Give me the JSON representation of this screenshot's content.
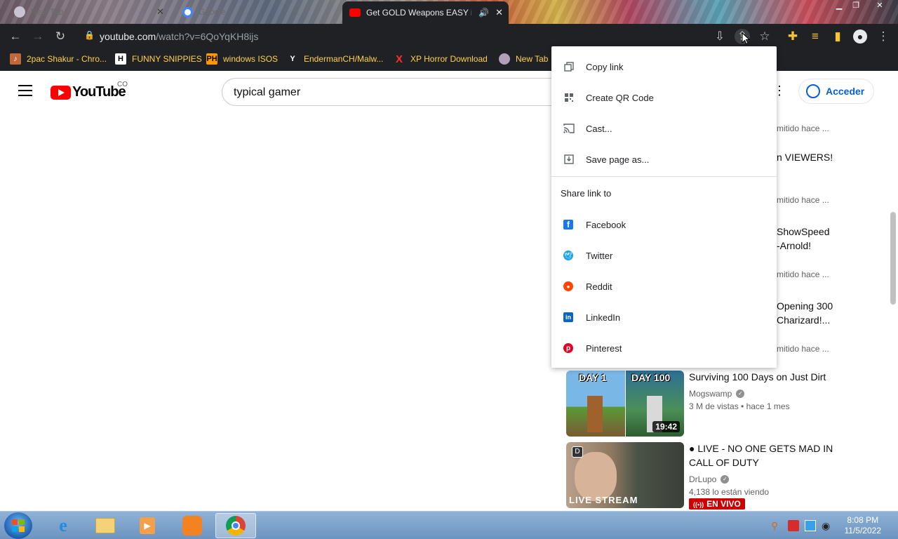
{
  "browser": {
    "tabs": [
      {
        "title": "New Tab",
        "active": false
      },
      {
        "title": "Google",
        "active": false
      },
      {
        "title": "Get GOLD Weapons EASY in",
        "active": true
      }
    ],
    "url_host": "youtube.com",
    "url_path": "/watch?v=6QoYqKH8ijs",
    "bookmarks": [
      {
        "label": "2pac Shakur - Chro...",
        "icon": "music-icon"
      },
      {
        "label": "FUNNY SNIPPIES",
        "icon": "h-logo-icon"
      },
      {
        "label": "windows ISOS",
        "icon": "ph-logo-icon"
      },
      {
        "label": "EndermanCH/Malw...",
        "icon": "y-logo-icon"
      },
      {
        "label": "XP Horror Download",
        "icon": "x-logo-icon"
      },
      {
        "label": "New Tab",
        "icon": "globe-icon"
      }
    ]
  },
  "youtube": {
    "logo_text": "YouTube",
    "country": "CO",
    "search_value": "typical gamer",
    "signin_label": "Acceder",
    "partial_items": [
      {
        "line1": "mitido hace ...",
        "line2": ""
      },
      {
        "line1": "n VIEWERS!",
        "line2": ""
      },
      {
        "line1": "mitido hace ...",
        "line2": ""
      },
      {
        "line1": "ShowSpeed",
        "line2": "-Arnold!"
      },
      {
        "line1": "mitido hace ...",
        "line2": ""
      },
      {
        "line1": "Opening 300",
        "line2": "Charizard!..."
      },
      {
        "line1": "mitido hace ...",
        "line2": ""
      }
    ],
    "videos": [
      {
        "title": "Surviving 100 Days on Just Dirt",
        "channel": "Mogswamp",
        "meta": "3 M de vistas  • hace 1 mes",
        "duration": "19:42",
        "thumb_text_left": "DAY 1",
        "thumb_text_right": "DAY 100"
      },
      {
        "title": "● LIVE - NO ONE GETS MAD IN CALL OF DUTY",
        "channel": "DrLupo",
        "meta": "4,138 lo están viendo",
        "badge": "EN VIVO",
        "thumb_text": "LIVE STREAM"
      }
    ]
  },
  "share_menu": {
    "items": [
      {
        "label": "Copy link",
        "icon": "copy-icon"
      },
      {
        "label": "Create QR Code",
        "icon": "qr-code-icon"
      },
      {
        "label": "Cast...",
        "icon": "cast-icon"
      },
      {
        "label": "Save page as...",
        "icon": "save-icon"
      }
    ],
    "share_header": "Share link to",
    "share_targets": [
      {
        "label": "Facebook",
        "icon": "facebook-icon",
        "color": "#1877f2"
      },
      {
        "label": "Twitter",
        "icon": "twitter-icon",
        "color": "#1da1f2"
      },
      {
        "label": "Reddit",
        "icon": "reddit-icon",
        "color": "#ff4500"
      },
      {
        "label": "LinkedIn",
        "icon": "linkedin-icon",
        "color": "#0a66c2"
      },
      {
        "label": "Pinterest",
        "icon": "pinterest-icon",
        "color": "#e60023"
      }
    ]
  },
  "taskbar": {
    "time": "8:08 PM",
    "date": "11/5/2022"
  }
}
